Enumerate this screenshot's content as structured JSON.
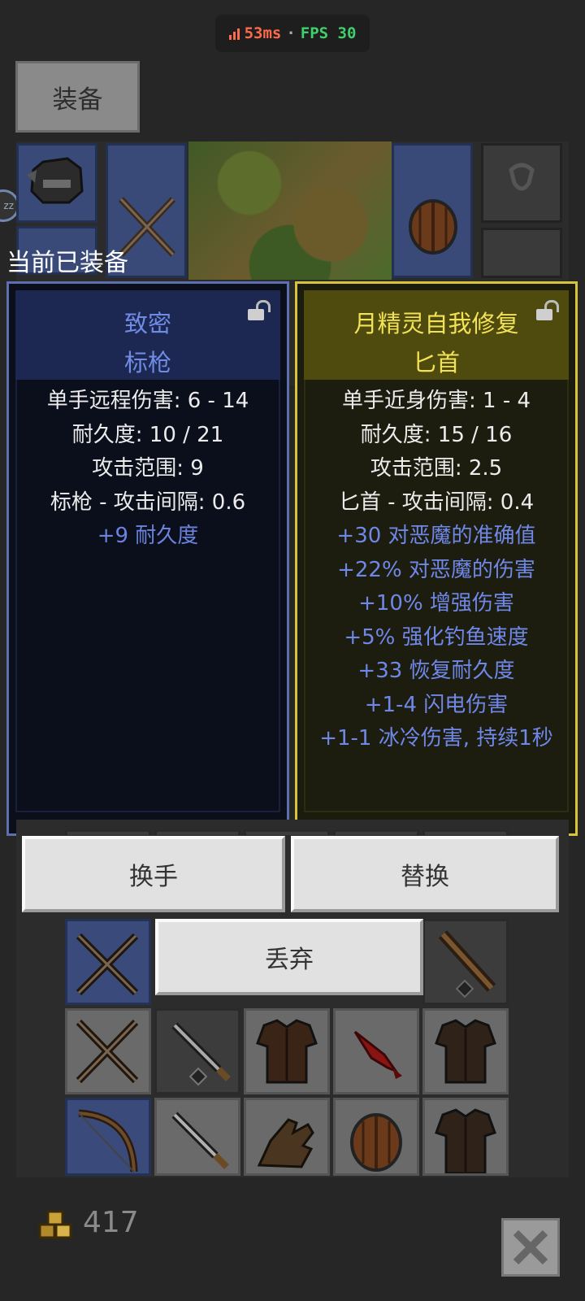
{
  "status": {
    "ping": "53ms",
    "separator": "·",
    "fps": "FPS 30"
  },
  "tab": {
    "equipment_label": "装备"
  },
  "section": {
    "equipped_label": "当前已装备"
  },
  "left_item": {
    "title_line1": "致密",
    "title_line2": "标枪",
    "stats": [
      "单手远程伤害: 6 - 14",
      "耐久度: 10 / 21",
      "攻击范围: 9",
      "标枪 - 攻击间隔: 0.6"
    ],
    "bonuses": [
      "+9 耐久度"
    ]
  },
  "right_item": {
    "title_line1": "月精灵自我修复",
    "title_line2": "匕首",
    "stats": [
      "单手近身伤害: 1 - 4",
      "耐久度: 15 / 16",
      "攻击范围: 2.5",
      "匕首 - 攻击间隔: 0.4"
    ],
    "bonuses": [
      "+30 对恶魔的准确值",
      "+22% 对恶魔的伤害",
      "+10% 增强伤害",
      "+5% 强化钓鱼速度",
      "+33 恢复耐久度",
      "+1-4 闪电伤害",
      "+1-1 冰冷伤害, 持续1秒"
    ]
  },
  "actions": {
    "swap_hand": "换手",
    "replace": "替换",
    "discard": "丢弃"
  },
  "gold": {
    "amount": "417"
  },
  "colors": {
    "magic_blue": "#6f88e8",
    "rare_yellow": "#f1e257",
    "ping_red": "#ff6a4d",
    "fps_green": "#3fd06b"
  }
}
